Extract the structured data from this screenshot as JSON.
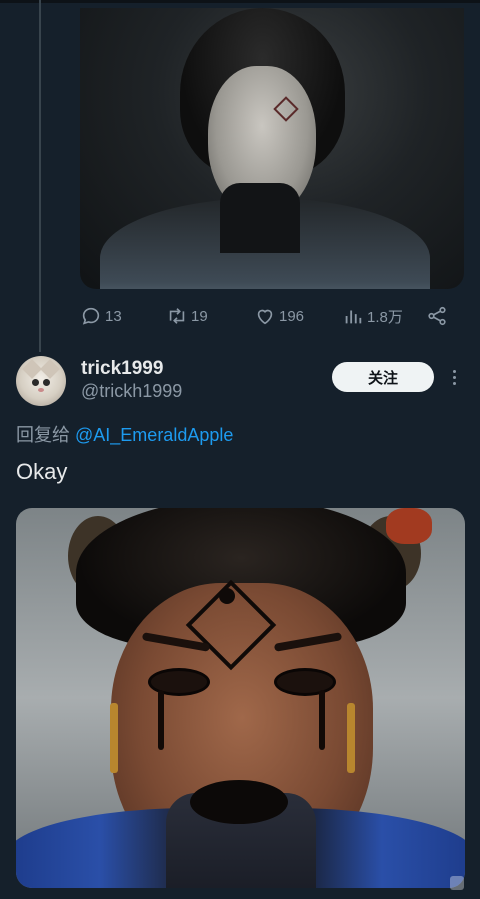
{
  "thread": {
    "first_tweet_actions": {
      "replies": "13",
      "retweets": "19",
      "likes": "196",
      "views": "1.8万"
    }
  },
  "reply": {
    "display_name": "trick1999",
    "handle": "@trickh1999",
    "follow_label": "关注",
    "reply_prefix": "回复给",
    "reply_mention": "@AI_EmeraldApple",
    "text": "Okay"
  },
  "icons": {
    "reply": "reply-icon",
    "retweet": "retweet-icon",
    "like": "heart-icon",
    "views": "analytics-icon",
    "share": "share-icon",
    "more": "more-icon"
  },
  "colors": {
    "background": "#15202b",
    "text_primary": "#e7e9ea",
    "text_secondary": "#8b98a5",
    "accent": "#1d9bf0",
    "follow_button_bg": "#eff3f4"
  }
}
